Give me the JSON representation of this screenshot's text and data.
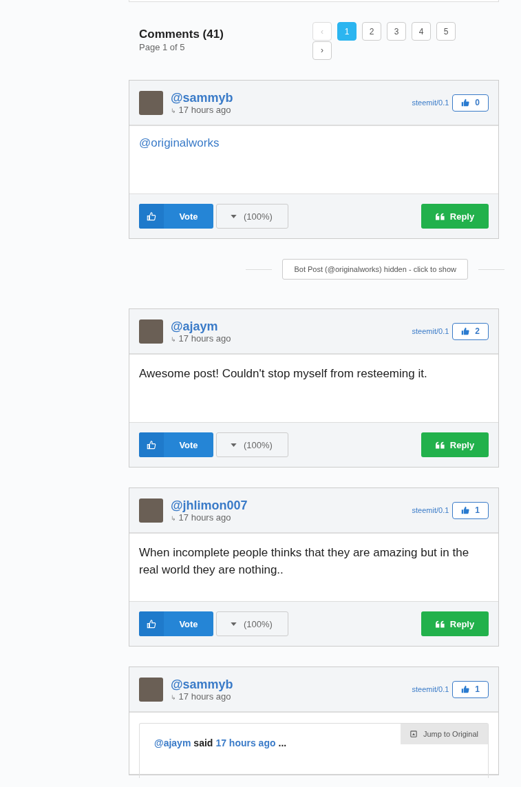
{
  "comments_header": {
    "title": "Comments (41)",
    "subtitle": "Page 1 of 5"
  },
  "pagination": {
    "prev": "‹",
    "next": "›",
    "pages": [
      {
        "label": "1",
        "selected": true
      },
      {
        "label": "2",
        "selected": false
      },
      {
        "label": "3",
        "selected": false
      },
      {
        "label": "4",
        "selected": false
      },
      {
        "label": "5",
        "selected": false
      }
    ]
  },
  "items": [
    {
      "kind": "comment",
      "author": "@sammyb",
      "reply_mark": "↳",
      "time": "17 hours ago",
      "app": "steemit/0.1",
      "votes": "0",
      "body": "@originalworks",
      "body_is_link": true,
      "vote_label": "Vote",
      "weight": "(100%)",
      "reply_label": "Reply"
    },
    {
      "kind": "hidden",
      "label": "Bot Post (@originalworks) hidden - click to show"
    },
    {
      "kind": "comment",
      "author": "@ajaym",
      "reply_mark": "↳",
      "time": "17 hours ago",
      "app": "steemit/0.1",
      "votes": "2",
      "body": "Awesome post! Couldn't stop myself from resteeming it.",
      "body_is_link": false,
      "vote_label": "Vote",
      "weight": "(100%)",
      "reply_label": "Reply"
    },
    {
      "kind": "comment",
      "author": "@jhlimon007",
      "reply_mark": "↳",
      "time": "17 hours ago",
      "app": "steemit/0.1",
      "votes": "1",
      "body": "When incomplete people thinks that they are amazing but in the real world they are nothing..",
      "body_is_link": false,
      "vote_label": "Vote",
      "weight": "(100%)",
      "reply_label": "Reply"
    },
    {
      "kind": "quote",
      "author": "@sammyb",
      "reply_mark": "↳",
      "time": "17 hours ago",
      "app": "steemit/0.1",
      "votes": "1",
      "quote_author": "@ajaym",
      "quote_said": "said",
      "quote_time": "17 hours ago",
      "quote_ellipsis": "...",
      "jump_label": "Jump to Original"
    }
  ]
}
